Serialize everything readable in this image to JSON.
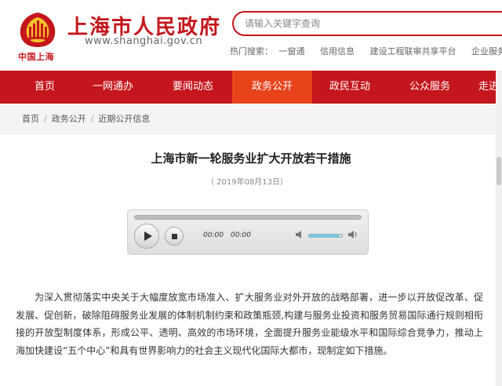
{
  "header": {
    "site_title": "上海市人民政府",
    "site_url": "www.shanghai.gov.cn",
    "emblem_label": "中国上海",
    "search": {
      "placeholder": "请输入关键字查询"
    },
    "hot_search": {
      "label": "热门搜索：",
      "items": [
        "一窗通",
        "信用信息",
        "建设工程联审共享平台",
        "企业服务云"
      ]
    }
  },
  "nav": {
    "items": [
      {
        "label": "首页"
      },
      {
        "label": "一网通办"
      },
      {
        "label": "要闻动态"
      },
      {
        "label": "政务公开",
        "active": true
      },
      {
        "label": "政民互动"
      },
      {
        "label": "公众服务"
      },
      {
        "label": "走进"
      }
    ]
  },
  "breadcrumb": [
    "首页",
    "政务公开",
    "近期公开信息"
  ],
  "article": {
    "title": "上海市新一轮服务业扩大开放若干措施",
    "date": "（ 2019年08月13日）",
    "body": "为深入贯彻落实中央关于大幅度放宽市场准入、扩大服务业对外开放的战略部署，进一步以开放促改革、促发展、促创新，破除阻碍服务业发展的体制机制约束和政策瓶颈,构建与服务业投资和服务贸易国际通行规则相衔接的开放型制度体系，形成公平、透明、高效的市场环境，全面提升服务业能级水平和国际综合竞争力，推动上海加快建设“五个中心”和具有世界影响力的社会主义现代化国际大都市，现制定如下措施。"
  },
  "player": {
    "current_time": "00:00",
    "duration": "00:00",
    "volume_level": 0.9
  },
  "colors": {
    "brand_red": "#c4161c",
    "nav_active": "#e8431b"
  }
}
